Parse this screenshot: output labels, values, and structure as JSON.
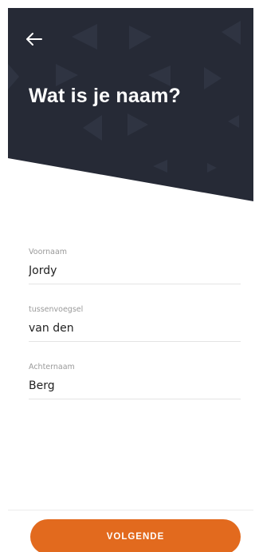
{
  "header": {
    "title": "Wat is je naam?",
    "back_icon": "arrow-left-icon",
    "background_color": "#262a36"
  },
  "form": {
    "fields": [
      {
        "label": "Voornaam",
        "value": "Jordy"
      },
      {
        "label": "tussenvoegsel",
        "value": "van den"
      },
      {
        "label": "Achternaam",
        "value": "Berg"
      }
    ]
  },
  "footer": {
    "primary_button_label": "VOLGENDE",
    "accent_color": "#e26a1e"
  }
}
